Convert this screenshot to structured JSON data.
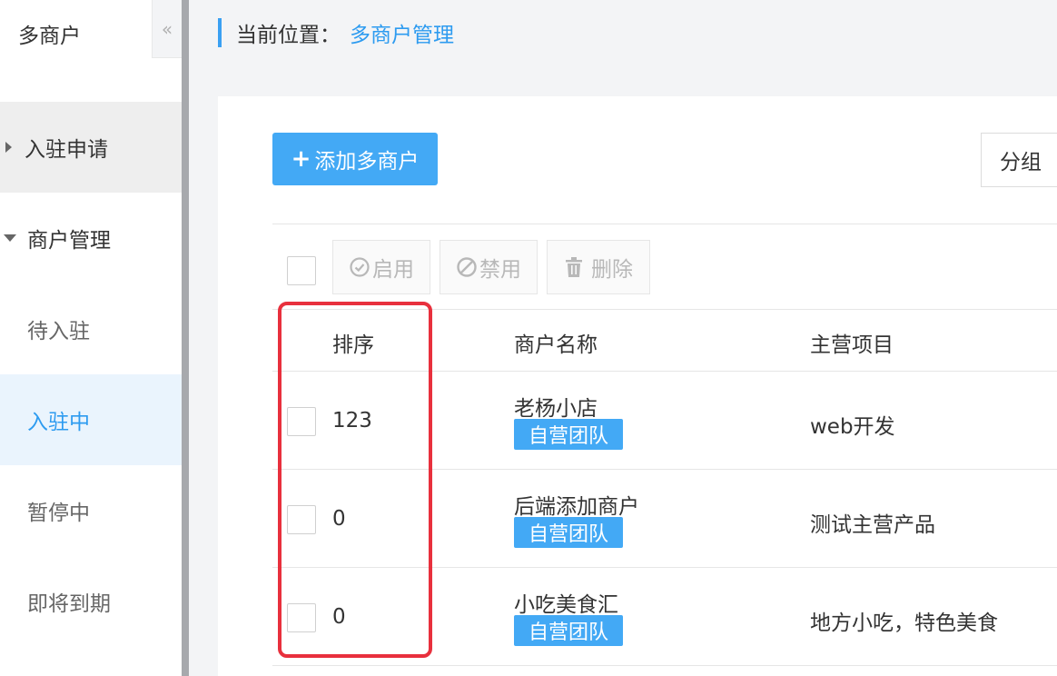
{
  "sidebar": {
    "title": "多商户",
    "collapse_icon": "«",
    "groups": [
      {
        "label": "入驻申请",
        "expanded": false
      },
      {
        "label": "商户管理",
        "expanded": true
      }
    ],
    "items": [
      {
        "label": "待入驻",
        "active": false
      },
      {
        "label": "入驻中",
        "active": true
      },
      {
        "label": "暂停中",
        "active": false
      },
      {
        "label": "即将到期",
        "active": false
      }
    ]
  },
  "breadcrumb": {
    "prefix": "当前位置：",
    "current": "多商户管理"
  },
  "toolbar": {
    "add_label": "添加多商户",
    "group_label": "分组",
    "enable_label": "启用",
    "disable_label": "禁用",
    "delete_label": "删除"
  },
  "table": {
    "headers": [
      "排序",
      "商户名称",
      "主营项目"
    ],
    "rows": [
      {
        "sort": "123",
        "name": "老杨小店",
        "tag": "自营团队",
        "business": "web开发"
      },
      {
        "sort": "0",
        "name": "后端添加商户",
        "tag": "自营团队",
        "business": "测试主营产品"
      },
      {
        "sort": "0",
        "name": "小吃美食汇",
        "tag": "自营团队",
        "business": "地方小吃，特色美食"
      }
    ]
  },
  "colors": {
    "accent": "#43a9f5",
    "highlight": "#e8303d",
    "active_bg": "#eaf4fd"
  }
}
